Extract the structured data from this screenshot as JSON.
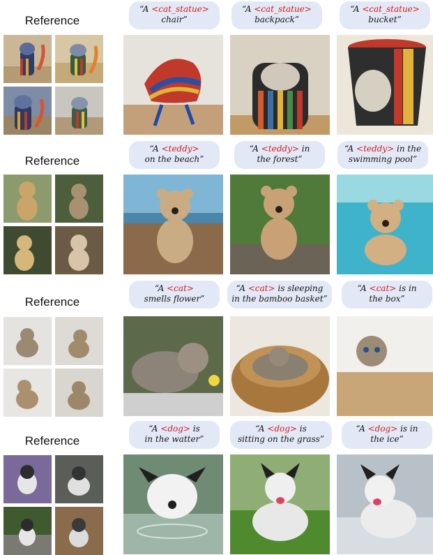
{
  "rows": [
    {
      "reference_label": "Reference",
      "prompts": [
        {
          "pre": "“A ",
          "token": "<cat_statue>",
          "post": "",
          "line2": "chair”"
        },
        {
          "pre": "“A ",
          "token": "<cat_statue>",
          "post": "",
          "line2": "backpack”"
        },
        {
          "pre": "“A ",
          "token": "<cat_statue>",
          "post": "",
          "line2": "bucket”"
        }
      ]
    },
    {
      "reference_label": "Reference",
      "prompts": [
        {
          "pre": "“A ",
          "token": "<teddy>",
          "post": "",
          "line2": "on the beach”"
        },
        {
          "pre": "“A ",
          "token": "<teddy>",
          "post": " in",
          "line2": "the forest”"
        },
        {
          "pre": "“A ",
          "token": "<teddy>",
          "post": " in the",
          "line2": "swimming pool”"
        }
      ]
    },
    {
      "reference_label": "Reference",
      "prompts": [
        {
          "pre": "“A ",
          "token": "<cat>",
          "post": "",
          "line2": "smells flower”"
        },
        {
          "pre": "“A ",
          "token": "<cat>",
          "post": " is sleeping",
          "line2": "in the bamboo basket”"
        },
        {
          "pre": "“A ",
          "token": "<cat>",
          "post": " is in",
          "line2": "the box”"
        }
      ]
    },
    {
      "reference_label": "Reference",
      "prompts": [
        {
          "pre": "“A ",
          "token": "<dog>",
          "post": " is",
          "line2": "in the watter”"
        },
        {
          "pre": "“A ",
          "token": "<dog>",
          "post": " is",
          "line2": "sitting on the grass”"
        },
        {
          "pre": "“A ",
          "token": "<dog>",
          "post": " is in",
          "line2": "the ice”"
        }
      ]
    }
  ],
  "colors": {
    "token": "#d11c1c",
    "bubble": "#e3e8f6"
  }
}
